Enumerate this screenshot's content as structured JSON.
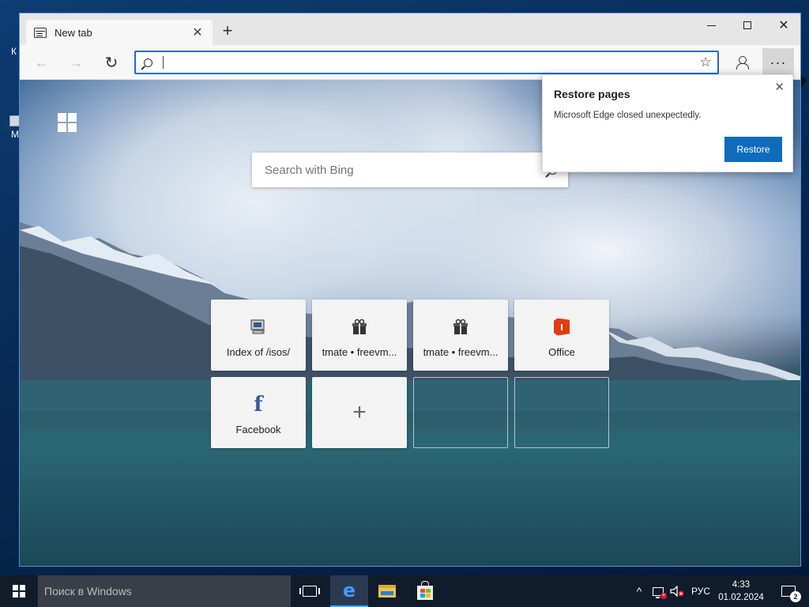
{
  "desktop": {
    "icons": [
      {
        "label": "К"
      },
      {
        "label": "M"
      }
    ]
  },
  "tab": {
    "title": "New tab",
    "close_glyph": "✕",
    "icon": "tab-page-icon"
  },
  "new_tab": {
    "glyph": "+"
  },
  "window_controls": {
    "close_glyph": "✕"
  },
  "nav": {
    "back_glyph": "←",
    "forward_glyph": "→",
    "refresh_glyph": "↻"
  },
  "address": {
    "value": "",
    "favorite_glyph": "☆"
  },
  "menu": {
    "more_glyph": "···"
  },
  "newtab_page": {
    "search_placeholder": "Search with Bing"
  },
  "tiles": [
    {
      "label": "Index of /isos/",
      "icon": "computer-icon"
    },
    {
      "label": "tmate • freevm...",
      "icon": "gift-icon"
    },
    {
      "label": "tmate • freevm...",
      "icon": "gift-icon"
    },
    {
      "label": "Office",
      "icon": "office-icon"
    },
    {
      "label": "Facebook",
      "icon": "facebook-icon",
      "glyph": "f"
    },
    {
      "label": "",
      "icon": "plus-icon",
      "glyph": "+"
    }
  ],
  "popup": {
    "title": "Restore pages",
    "message": "Microsoft Edge closed unexpectedly.",
    "button": "Restore",
    "close_glyph": "✕"
  },
  "taskbar": {
    "search_placeholder": "Поиск в Windows",
    "edge_glyph": "e",
    "tray_chevron": "^",
    "language": "РУС",
    "time": "4:33",
    "date": "01.02.2024",
    "notification_count": "2"
  },
  "colors": {
    "accent": "#0f6cbd",
    "address_border": "#1c6fd1",
    "taskbar": "#101c2b",
    "office": "#e03c10",
    "facebook": "#3b5998"
  }
}
